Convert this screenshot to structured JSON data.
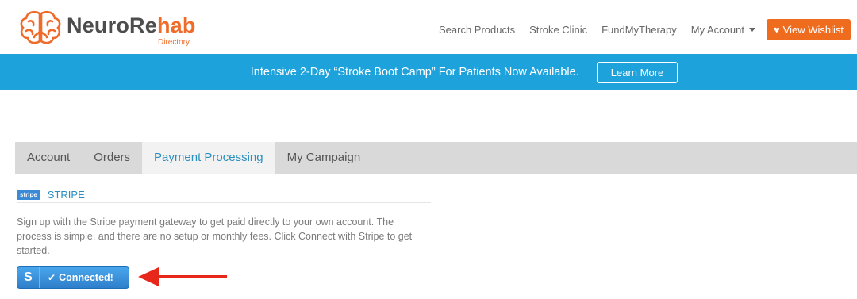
{
  "brand": {
    "name_prefix": "NeuroRe",
    "name_suffix": "hab",
    "subtitle": "Directory",
    "accent_color": "#ef6b2a"
  },
  "nav": {
    "items": [
      "Search Products",
      "Stroke Clinic",
      "FundMyTherapy"
    ],
    "account_label": "My Account",
    "wishlist_label": "View Wishlist",
    "wishlist_icon": "heart-icon"
  },
  "banner": {
    "text": "Intensive 2-Day “Stroke Boot Camp” For Patients Now Available.",
    "button_label": "Learn More",
    "color": "#1ea2dc"
  },
  "tabs": [
    {
      "label": "Account",
      "active": false
    },
    {
      "label": "Orders",
      "active": false
    },
    {
      "label": "Payment Processing",
      "active": true
    },
    {
      "label": "My Campaign",
      "active": false
    }
  ],
  "stripe": {
    "logo_text": "stripe",
    "title": "STRIPE",
    "description": "Sign up with the Stripe payment gateway to get paid directly to your own account. The process is simple, and there are no setup or monthly fees. Click Connect with Stripe to get started.",
    "button_icon_text": "S",
    "button_label": "Connected!",
    "button_icon": "check-icon"
  },
  "annotation": {
    "arrow_color": "#e8271b"
  }
}
